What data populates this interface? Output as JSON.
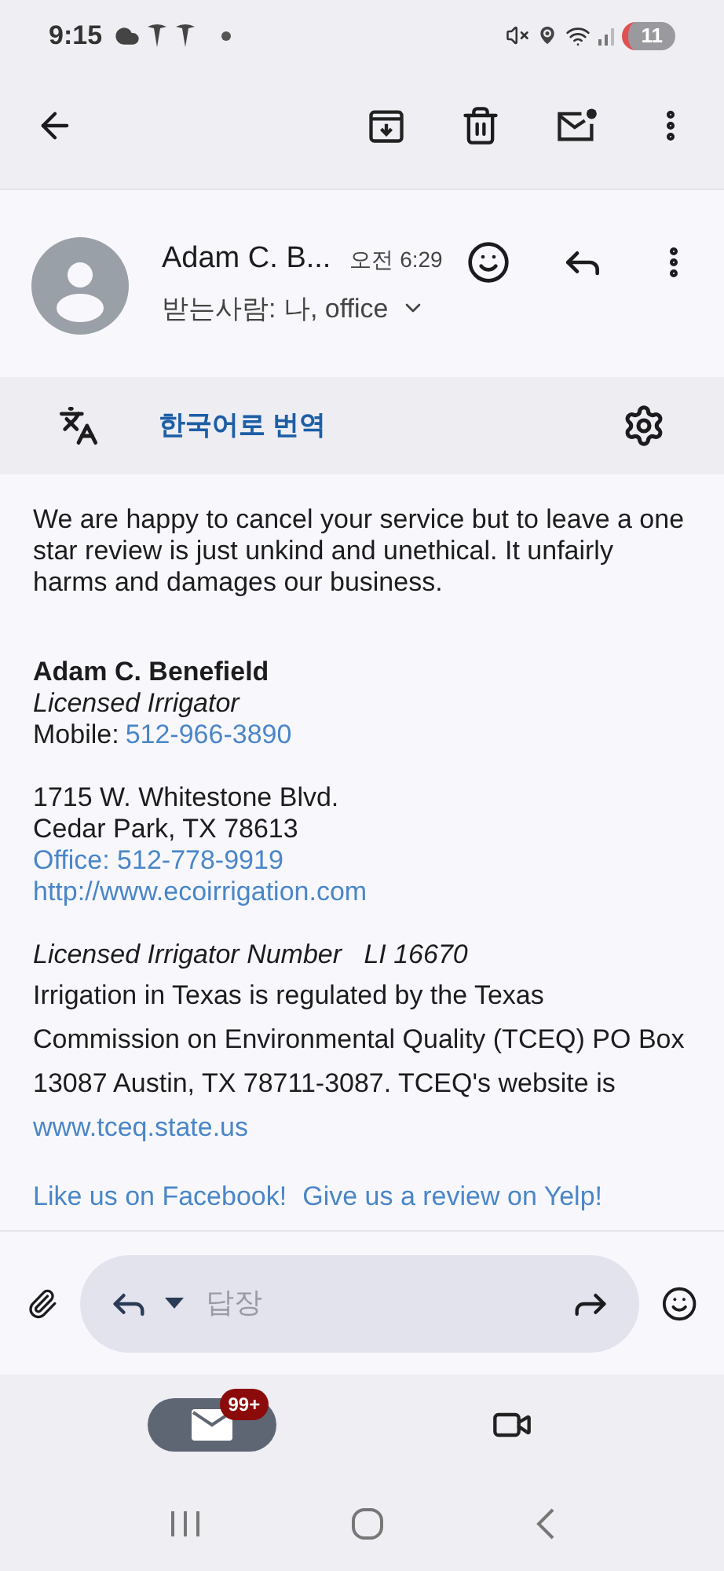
{
  "status_bar": {
    "time": "9:15",
    "battery": "11"
  },
  "message": {
    "sender": "Adam C. B...",
    "time": "오전 6:29",
    "recipients": "받는사람: 나, office"
  },
  "translate": {
    "label": "한국어로 번역"
  },
  "body": {
    "paragraph": "We are happy to cancel your service but to leave a one star review is just unkind and unethical. It unfairly harms and damages our business.",
    "signature": [
      {
        "lines": [
          {
            "kind": "bold",
            "text": "Adam C. Benefield"
          },
          {
            "kind": "italic",
            "text": "Licensed Irrigator"
          },
          {
            "kind": "labeled",
            "label": "Mobile:",
            "link": "512-966-3890"
          }
        ]
      },
      {
        "lines": [
          {
            "kind": "plain",
            "text": "1715 W. Whitestone Blvd."
          },
          {
            "kind": "plain",
            "text": "Cedar Park, TX 78613"
          },
          {
            "kind": "link",
            "text": "Office: 512-778-9919"
          },
          {
            "kind": "link",
            "text": "http://www.ecoirrigation.com"
          }
        ]
      },
      {
        "lines": [
          {
            "kind": "italic",
            "text": "Licensed Irrigator Number   LI 16670"
          },
          {
            "kind": "note",
            "text": "Irrigation in Texas is regulated by the Texas Commission on Environmental Quality (TCEQ) PO Box 13087 Austin, TX 78711-3087. TCEQ's website is",
            "link": "www.tceq.state.us"
          }
        ]
      },
      {
        "lines": [
          {
            "kind": "links",
            "links": [
              "Like us on Facebook!",
              "Give us a review on Yelp!"
            ]
          }
        ]
      }
    ]
  },
  "reply": {
    "placeholder": "답장"
  },
  "bottom_nav": [
    {
      "kind": "mail",
      "badge": "99+",
      "selected": true
    },
    {
      "kind": "video",
      "selected": false
    }
  ]
}
